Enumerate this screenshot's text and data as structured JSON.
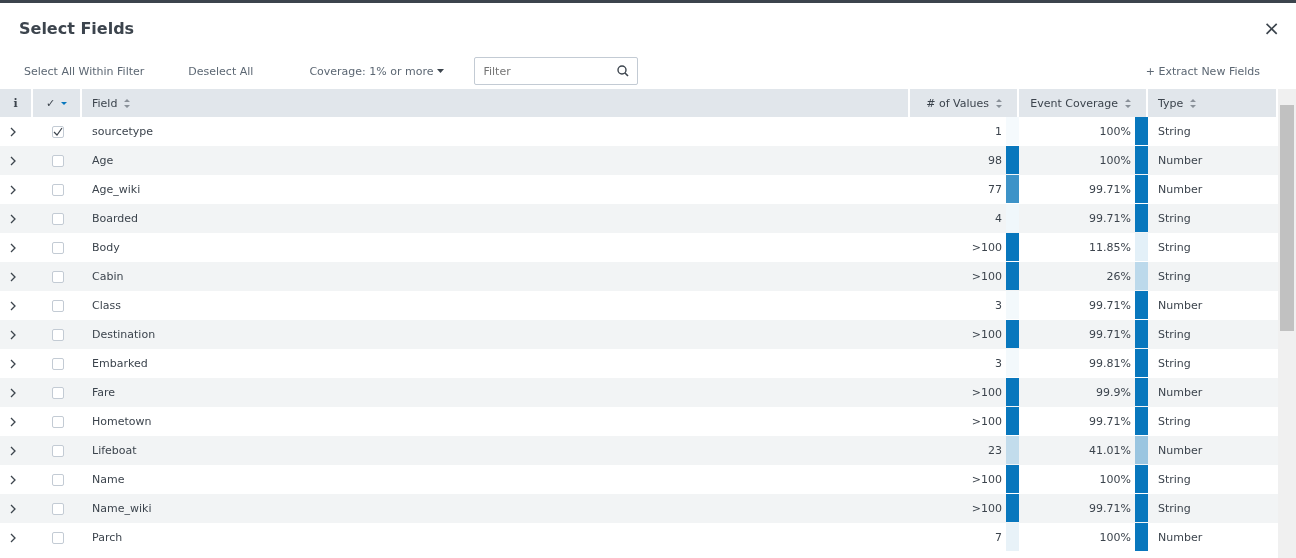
{
  "dialog": {
    "title": "Select Fields",
    "close": "×"
  },
  "toolbar": {
    "select_all": "Select All Within Filter",
    "deselect_all": "Deselect All",
    "coverage": "Coverage: 1% or more",
    "filter": {
      "placeholder": "Filter"
    },
    "extract": "+ Extract New Fields"
  },
  "table": {
    "columns": [
      {
        "label": "i",
        "kind": "info"
      },
      {
        "label": "✓",
        "kind": "check"
      },
      {
        "label": "Field",
        "kind": "field"
      },
      {
        "label": "# of Values",
        "kind": "values"
      },
      {
        "label": "Event Coverage",
        "kind": "coverage"
      },
      {
        "label": "Type",
        "kind": "type"
      }
    ],
    "rows": [
      {
        "field": "sourcetype",
        "checked": true,
        "values": "1",
        "values_bar": {
          "color": "#f5fafd"
        },
        "coverage": "100%",
        "coverage_bar": {
          "color": "#0877bd"
        },
        "type": "String"
      },
      {
        "field": "Age",
        "checked": false,
        "values": "98",
        "values_bar": {
          "color": "#0877bd"
        },
        "coverage": "100%",
        "coverage_bar": {
          "color": "#0877bd"
        },
        "type": "Number"
      },
      {
        "field": "Age_wiki",
        "checked": false,
        "values": "77",
        "values_bar": {
          "color": "#3d93c8"
        },
        "coverage": "99.71%",
        "coverage_bar": {
          "color": "#0877bd"
        },
        "type": "Number"
      },
      {
        "field": "Boarded",
        "checked": false,
        "values": "4",
        "values_bar": {
          "color": "#f0f7fb"
        },
        "coverage": "99.71%",
        "coverage_bar": {
          "color": "#0877bd"
        },
        "type": "String"
      },
      {
        "field": "Body",
        "checked": false,
        "values": ">100",
        "values_bar": {
          "color": "#0877bd"
        },
        "coverage": "11.85%",
        "coverage_bar": {
          "color": "#e3f0f8"
        },
        "type": "String"
      },
      {
        "field": "Cabin",
        "checked": false,
        "values": ">100",
        "values_bar": {
          "color": "#0877bd"
        },
        "coverage": "26%",
        "coverage_bar": {
          "color": "#bcd9eb"
        },
        "type": "String"
      },
      {
        "field": "Class",
        "checked": false,
        "values": "3",
        "values_bar": {
          "color": "#f3f9fc"
        },
        "coverage": "99.71%",
        "coverage_bar": {
          "color": "#0877bd"
        },
        "type": "Number"
      },
      {
        "field": "Destination",
        "checked": false,
        "values": ">100",
        "values_bar": {
          "color": "#0877bd"
        },
        "coverage": "99.71%",
        "coverage_bar": {
          "color": "#0877bd"
        },
        "type": "String"
      },
      {
        "field": "Embarked",
        "checked": false,
        "values": "3",
        "values_bar": {
          "color": "#f3f9fc"
        },
        "coverage": "99.81%",
        "coverage_bar": {
          "color": "#0877bd"
        },
        "type": "String"
      },
      {
        "field": "Fare",
        "checked": false,
        "values": ">100",
        "values_bar": {
          "color": "#0877bd"
        },
        "coverage": "99.9%",
        "coverage_bar": {
          "color": "#0877bd"
        },
        "type": "Number"
      },
      {
        "field": "Hometown",
        "checked": false,
        "values": ">100",
        "values_bar": {
          "color": "#0877bd"
        },
        "coverage": "99.71%",
        "coverage_bar": {
          "color": "#0877bd"
        },
        "type": "String"
      },
      {
        "field": "Lifeboat",
        "checked": false,
        "values": "23",
        "values_bar": {
          "color": "#c2dcec"
        },
        "coverage": "41.01%",
        "coverage_bar": {
          "color": "#9ac5e0"
        },
        "type": "Number"
      },
      {
        "field": "Name",
        "checked": false,
        "values": ">100",
        "values_bar": {
          "color": "#0877bd"
        },
        "coverage": "100%",
        "coverage_bar": {
          "color": "#0877bd"
        },
        "type": "String"
      },
      {
        "field": "Name_wiki",
        "checked": false,
        "values": ">100",
        "values_bar": {
          "color": "#0877bd"
        },
        "coverage": "99.71%",
        "coverage_bar": {
          "color": "#0877bd"
        },
        "type": "String"
      },
      {
        "field": "Parch",
        "checked": false,
        "values": "7",
        "values_bar": {
          "color": "#e8f2f8"
        },
        "coverage": "100%",
        "coverage_bar": {
          "color": "#0877bd"
        },
        "type": "Number"
      }
    ]
  }
}
